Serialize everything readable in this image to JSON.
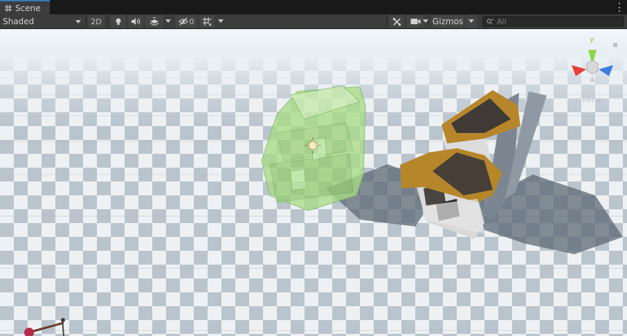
{
  "tabs": [
    {
      "label": "Scene",
      "icon": "grid-icon"
    }
  ],
  "toolbar": {
    "draw_mode": "Shaded",
    "toggle_2d": "2D",
    "hidden_count": "0",
    "gizmos_label": "Gizmos",
    "search_placeholder": "All"
  },
  "orientation_gizmo": {
    "axis_y_label": "y",
    "projection_label": "Persp",
    "colors": {
      "y": "#8bd84b",
      "x": "#e64137",
      "z": "#3d7ee0"
    }
  },
  "scene": {
    "objects": [
      "house-transparent-green",
      "house-thatched-roof",
      "character-prop"
    ],
    "colors": {
      "sky": "#e7f0f5",
      "horizon": "#c9d7e0",
      "tile_light": "#f4f6f8",
      "tile_dark": "#b9c4ce",
      "roof": "#b88a2a",
      "wall": "#d9d9d9",
      "ghost": "#9fd97a"
    }
  }
}
